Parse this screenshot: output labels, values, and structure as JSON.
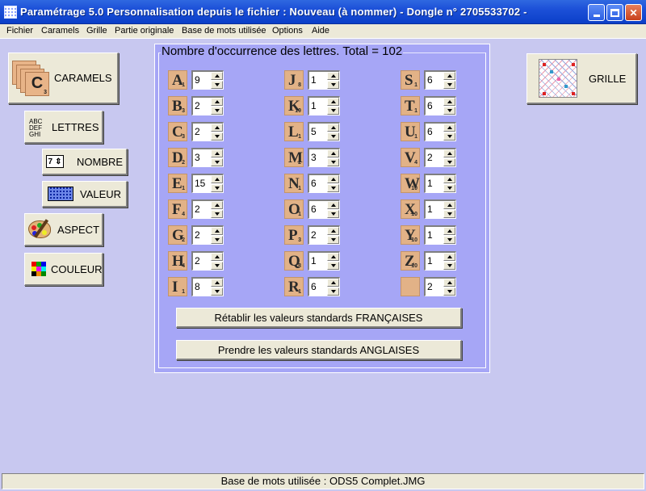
{
  "window": {
    "title": "Paramétrage 5.0  Personnalisation depuis le fichier :  Nouveau (à nommer) - Dongle n°  2705533702 -"
  },
  "menu": [
    "Fichier",
    "Caramels",
    "Grille",
    "Partie originale",
    "Base de mots utilisée",
    "Options",
    "Aide"
  ],
  "sidebar": {
    "caramels": {
      "label": "CARAMELS",
      "icon": "caramels-stack-icon",
      "tile_letter": "C",
      "tile_points": "3"
    },
    "lettres": {
      "label": "LETTRES",
      "icon": "abc-letters-icon",
      "icon_text": [
        "ABC",
        "DEF",
        "GHI"
      ]
    },
    "nombre": {
      "label": "NOMBRE",
      "icon": "number-spinner-icon",
      "icon_text": "7"
    },
    "valeur": {
      "label": "VALEUR",
      "icon": "keypad-icon"
    },
    "aspect": {
      "label": "ASPECT",
      "icon": "palette-icon"
    },
    "couleur": {
      "label": "COULEUR",
      "icon": "color-grid-icon"
    }
  },
  "grille_button": {
    "label": "GRILLE",
    "icon": "board-grid-icon"
  },
  "panel": {
    "title": "Nombre d'occurrence des lettres. Total = 102",
    "letters": [
      {
        "letter": "A",
        "points": "1",
        "count": "9"
      },
      {
        "letter": "B",
        "points": "3",
        "count": "2"
      },
      {
        "letter": "C",
        "points": "3",
        "count": "2"
      },
      {
        "letter": "D",
        "points": "2",
        "count": "3"
      },
      {
        "letter": "E",
        "points": "1",
        "count": "15"
      },
      {
        "letter": "F",
        "points": "4",
        "count": "2"
      },
      {
        "letter": "G",
        "points": "2",
        "count": "2"
      },
      {
        "letter": "H",
        "points": "4",
        "count": "2"
      },
      {
        "letter": "I",
        "points": "1",
        "count": "8"
      },
      {
        "letter": "J",
        "points": "8",
        "count": "1"
      },
      {
        "letter": "K",
        "points": "10",
        "count": "1"
      },
      {
        "letter": "L",
        "points": "1",
        "count": "5"
      },
      {
        "letter": "M",
        "points": "2",
        "count": "3"
      },
      {
        "letter": "N",
        "points": "1",
        "count": "6"
      },
      {
        "letter": "O",
        "points": "1",
        "count": "6"
      },
      {
        "letter": "P",
        "points": "3",
        "count": "2"
      },
      {
        "letter": "Q",
        "points": "8",
        "count": "1"
      },
      {
        "letter": "R",
        "points": "1",
        "count": "6"
      },
      {
        "letter": "S",
        "points": "1",
        "count": "6"
      },
      {
        "letter": "T",
        "points": "1",
        "count": "6"
      },
      {
        "letter": "U",
        "points": "1",
        "count": "6"
      },
      {
        "letter": "V",
        "points": "4",
        "count": "2"
      },
      {
        "letter": "W",
        "points": "10",
        "count": "1"
      },
      {
        "letter": "X",
        "points": "10",
        "count": "1"
      },
      {
        "letter": "Y",
        "points": "10",
        "count": "1"
      },
      {
        "letter": "Z",
        "points": "10",
        "count": "1"
      },
      {
        "letter": "",
        "points": "",
        "count": "2"
      }
    ],
    "btn_fr": "Rétablir les valeurs standards FRANÇAISES",
    "btn_en": "Prendre les valeurs standards ANGLAISES"
  },
  "status": "Base de mots utilisée : ODS5 Complet.JMG",
  "colors": {
    "background": "#C8C8F0",
    "panel": "#A6A6F6",
    "tile": "#E2B287",
    "titlebar": "#0B3FC8",
    "button_face": "#ECE9D8"
  }
}
